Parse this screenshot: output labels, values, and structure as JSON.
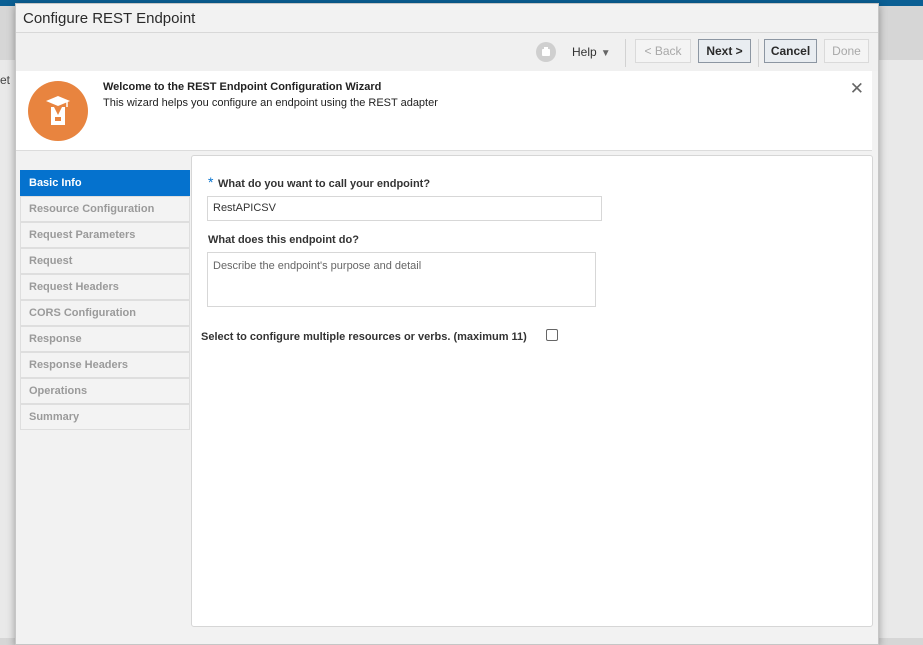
{
  "background": {
    "fragment_text": "et"
  },
  "dialog": {
    "title": "Configure REST Endpoint"
  },
  "toolbar": {
    "help_label": "Help",
    "help_caret": "▼",
    "back_label": "< Back",
    "next_label": "Next >",
    "cancel_label": "Cancel",
    "done_label": "Done"
  },
  "welcome": {
    "title": "Welcome to the REST Endpoint Configuration Wizard",
    "description": "This wizard helps you configure an endpoint using the REST adapter",
    "close_glyph": "✕"
  },
  "steps": [
    {
      "label": "Basic Info",
      "active": true
    },
    {
      "label": "Resource Configuration",
      "active": false
    },
    {
      "label": "Request Parameters",
      "active": false
    },
    {
      "label": "Request",
      "active": false
    },
    {
      "label": "Request Headers",
      "active": false
    },
    {
      "label": "CORS Configuration",
      "active": false
    },
    {
      "label": "Response",
      "active": false
    },
    {
      "label": "Response Headers",
      "active": false
    },
    {
      "label": "Operations",
      "active": false
    },
    {
      "label": "Summary",
      "active": false
    }
  ],
  "form": {
    "required_marker": "*",
    "name_label": "What do you want to call your endpoint?",
    "name_value": "RestAPICSV",
    "desc_label": "What does this endpoint do?",
    "desc_placeholder": "Describe the endpoint's purpose and detail",
    "multi_label": "Select to configure multiple resources or verbs. (maximum 11)",
    "multi_checked": false
  },
  "colors": {
    "accent": "#0572ce",
    "wizard_icon": "#e8843f",
    "top_strip": "#0a5f94"
  }
}
